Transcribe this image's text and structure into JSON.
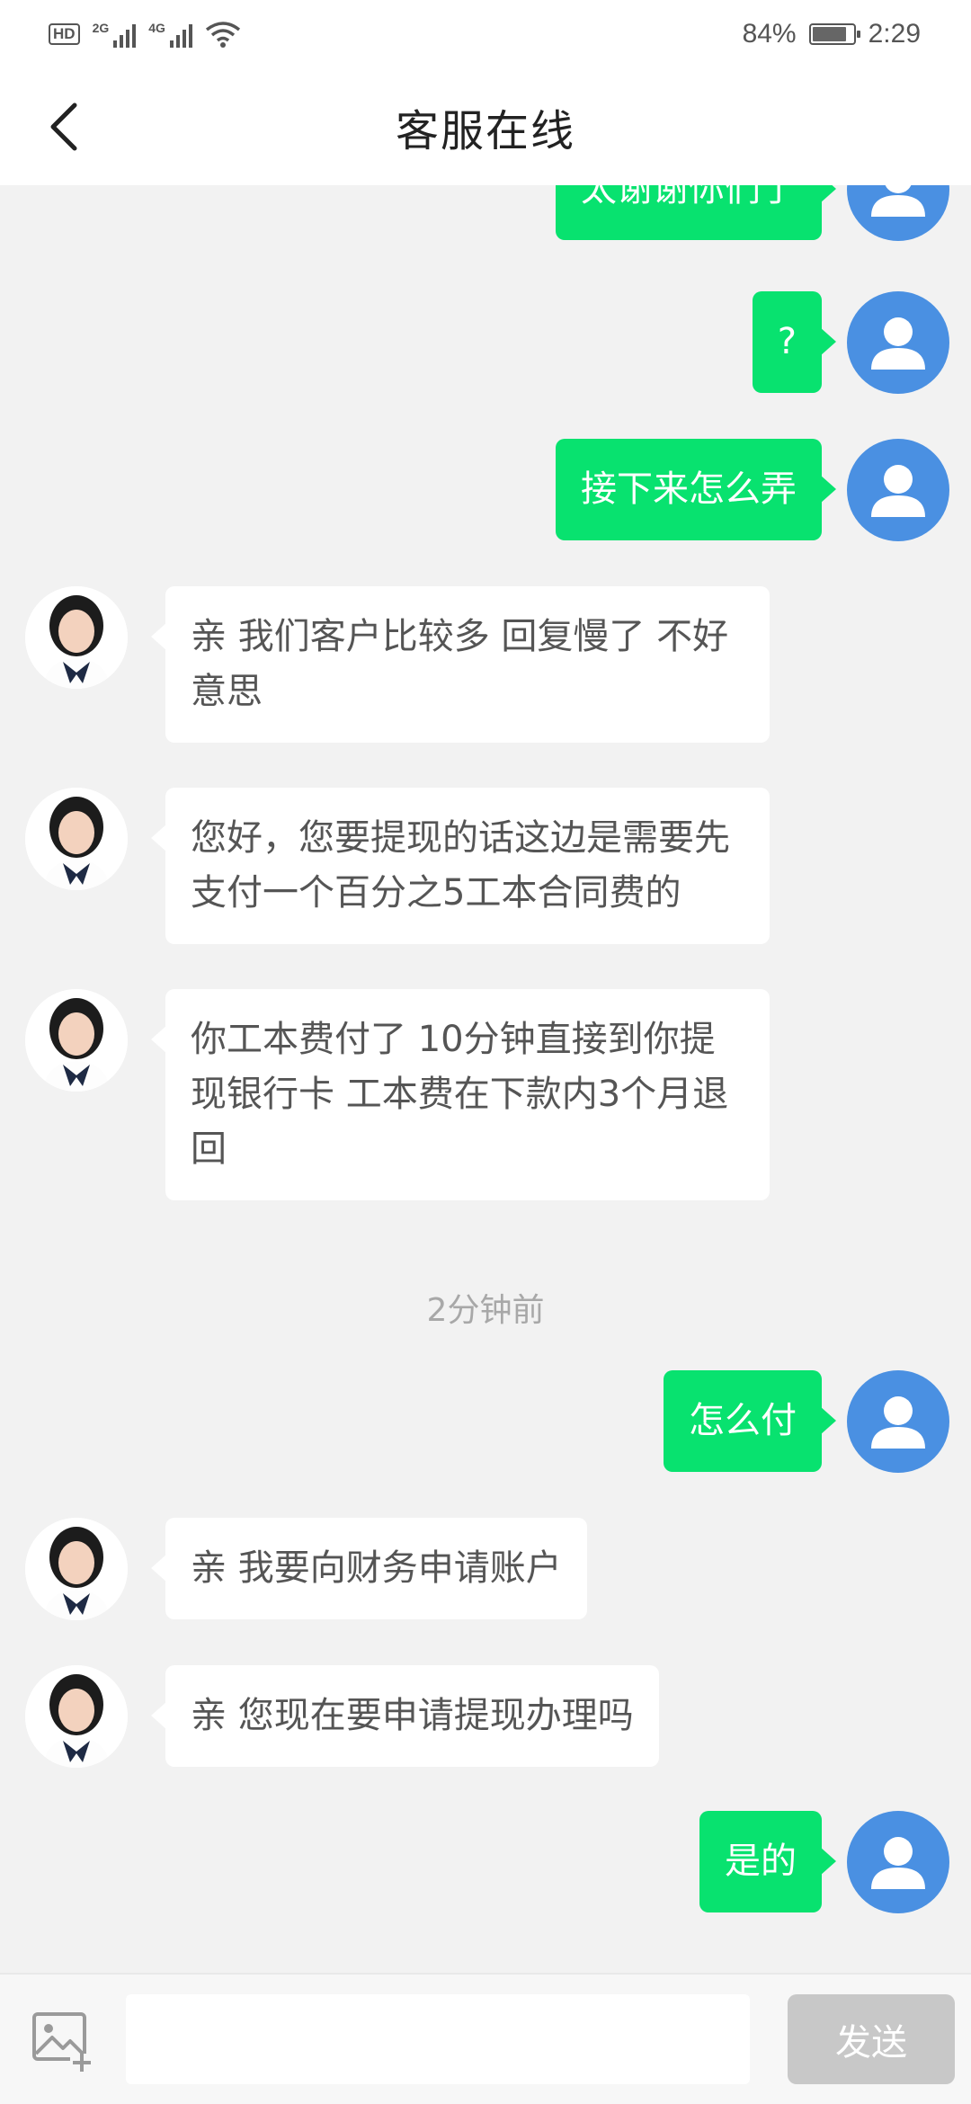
{
  "status_bar": {
    "hd": "HD",
    "net1": "2G",
    "net2": "4G",
    "battery_pct": "84%",
    "battery_level": 0.84,
    "time": "2:29"
  },
  "nav": {
    "title": "客服在线",
    "back_icon": "chevron-left-icon"
  },
  "messages": [
    {
      "from": "user",
      "text": "太谢谢你们了"
    },
    {
      "from": "user",
      "text": "?"
    },
    {
      "from": "user",
      "text": "接下来怎么弄"
    },
    {
      "from": "agent",
      "text": "亲 我们客户比较多 回复慢了 不好意思"
    },
    {
      "from": "agent",
      "text": "您好，您要提现的话这边是需要先支付一个百分之5工本合同费的"
    },
    {
      "from": "agent",
      "text": "你工本费付了 10分钟直接到你提现银行卡 工本费在下款内3个月退回"
    },
    {
      "from": "user",
      "text": "怎么付"
    },
    {
      "from": "agent",
      "text": "亲 我要向财务申请账户"
    },
    {
      "from": "agent",
      "text": "亲 您现在要申请提现办理吗"
    },
    {
      "from": "user",
      "text": "是的"
    }
  ],
  "time_separator": "2分钟前",
  "input": {
    "placeholder": "",
    "value": "",
    "send_label": "发送",
    "image_icon": "add-image-icon"
  },
  "colors": {
    "outgoing_bubble": "#08e26f",
    "user_avatar": "#4a90e2",
    "background": "#f2f2f2",
    "send_disabled": "#c8c8c8"
  }
}
